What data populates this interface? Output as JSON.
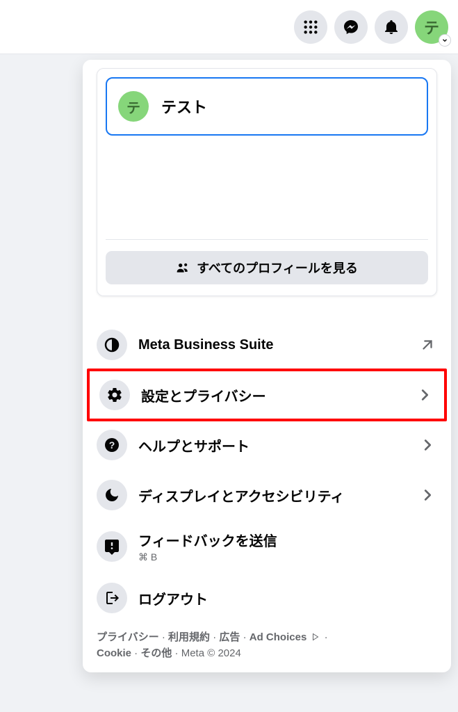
{
  "avatar_initial": "テ",
  "profile": {
    "avatar_initial": "テ",
    "name": "テスト",
    "all_profiles_label": "すべてのプロフィールを見る"
  },
  "menu": {
    "business": {
      "label": "Meta Business Suite"
    },
    "settings": {
      "label": "設定とプライバシー"
    },
    "help": {
      "label": "ヘルプとサポート"
    },
    "display": {
      "label": "ディスプレイとアクセシビリティ"
    },
    "feedback": {
      "label": "フィードバックを送信",
      "shortcut": "⌘ B"
    },
    "logout": {
      "label": "ログアウト"
    }
  },
  "footer": {
    "privacy": "プライバシー",
    "terms": "利用規約",
    "ads": "広告",
    "adchoices": "Ad Choices",
    "cookie": "Cookie",
    "more": "その他",
    "meta": "Meta © 2024"
  }
}
